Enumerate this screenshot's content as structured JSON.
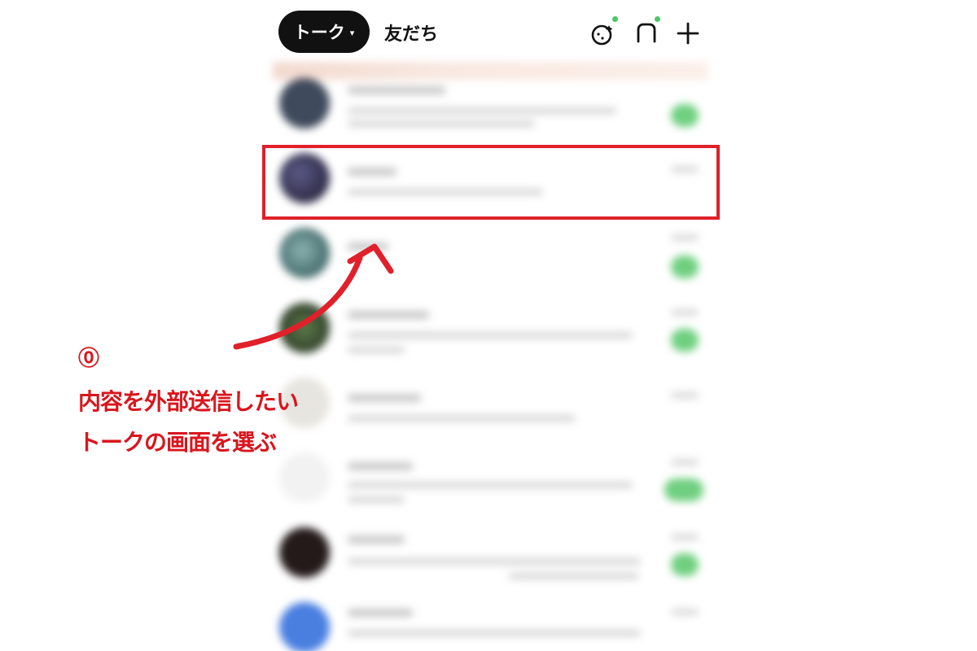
{
  "header": {
    "tab_talk_label": "トーク",
    "tab_talk_caret": "▾",
    "tab_friends_label": "友だち",
    "icons": [
      "face-sparkle-icon",
      "square-bubble-icon",
      "plus-icon"
    ]
  },
  "annotation": {
    "step_number": "⓪",
    "instruction_line1": "内容を外部送信したい",
    "instruction_line2": "トークの画面を選ぶ",
    "color": "#e0202a"
  },
  "colors": {
    "accent_green": "#4cc764",
    "tab_active_bg": "#111111",
    "annotation_red": "#d9151d"
  }
}
